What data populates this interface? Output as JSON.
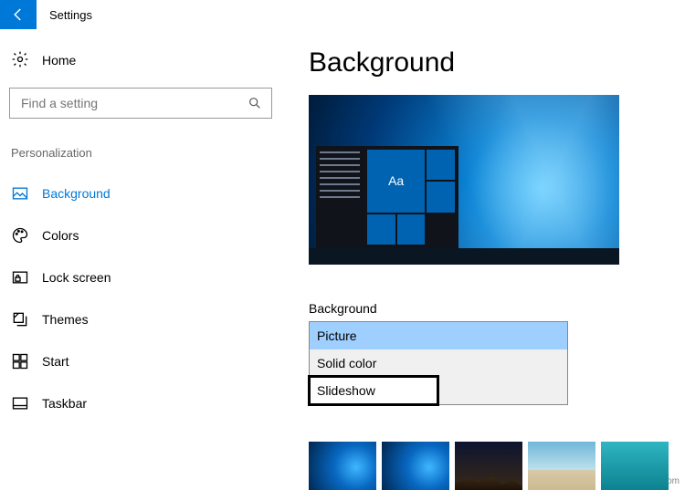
{
  "title": "Settings",
  "sidebar": {
    "home": "Home",
    "search_placeholder": "Find a setting",
    "section": "Personalization",
    "items": [
      {
        "label": "Background"
      },
      {
        "label": "Colors"
      },
      {
        "label": "Lock screen"
      },
      {
        "label": "Themes"
      },
      {
        "label": "Start"
      },
      {
        "label": "Taskbar"
      }
    ]
  },
  "content": {
    "heading": "Background",
    "preview_tile_text": "Aa",
    "dropdown_label": "Background",
    "options": [
      {
        "label": "Picture"
      },
      {
        "label": "Solid color"
      },
      {
        "label": "Slideshow"
      }
    ]
  },
  "watermark": "wsxdn.com"
}
